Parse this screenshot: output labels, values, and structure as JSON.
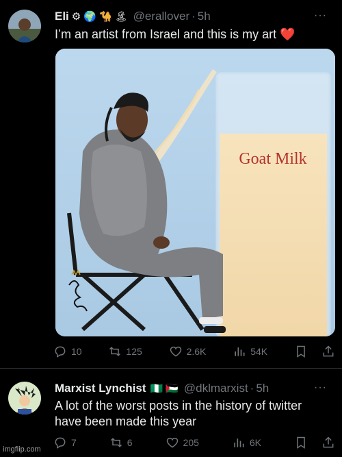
{
  "tweets": [
    {
      "display_name": "Eli",
      "badges": [
        "⚙",
        "🌍",
        "🐪",
        "🏝"
      ],
      "handle": "@erallover",
      "time": "5h",
      "text": "I’m an artist from Israel and this is my art ❤️",
      "image_text": "Goat Milk",
      "stats": {
        "replies": "10",
        "reposts": "125",
        "likes": "2.6K",
        "views": "54K"
      }
    },
    {
      "display_name": "Marxist Lynchist",
      "badges": [
        "🇳🇬",
        "🇵🇸"
      ],
      "handle": "@dklmarxist",
      "time": "5h",
      "text": "A lot of the worst posts in the history of twitter have been made this year",
      "stats": {
        "replies": "7",
        "reposts": "6",
        "likes": "205",
        "views": "6K"
      }
    }
  ],
  "more_glyph": "···",
  "dot_glyph": "·",
  "watermark": "imgflip.com",
  "colors": {
    "background": "#000000",
    "text": "#e7e9ea",
    "muted": "#71767b",
    "divider": "#2f3336"
  },
  "icons": [
    "reply-icon",
    "repost-icon",
    "like-icon",
    "views-icon",
    "bookmark-icon",
    "share-icon",
    "more-icon"
  ]
}
